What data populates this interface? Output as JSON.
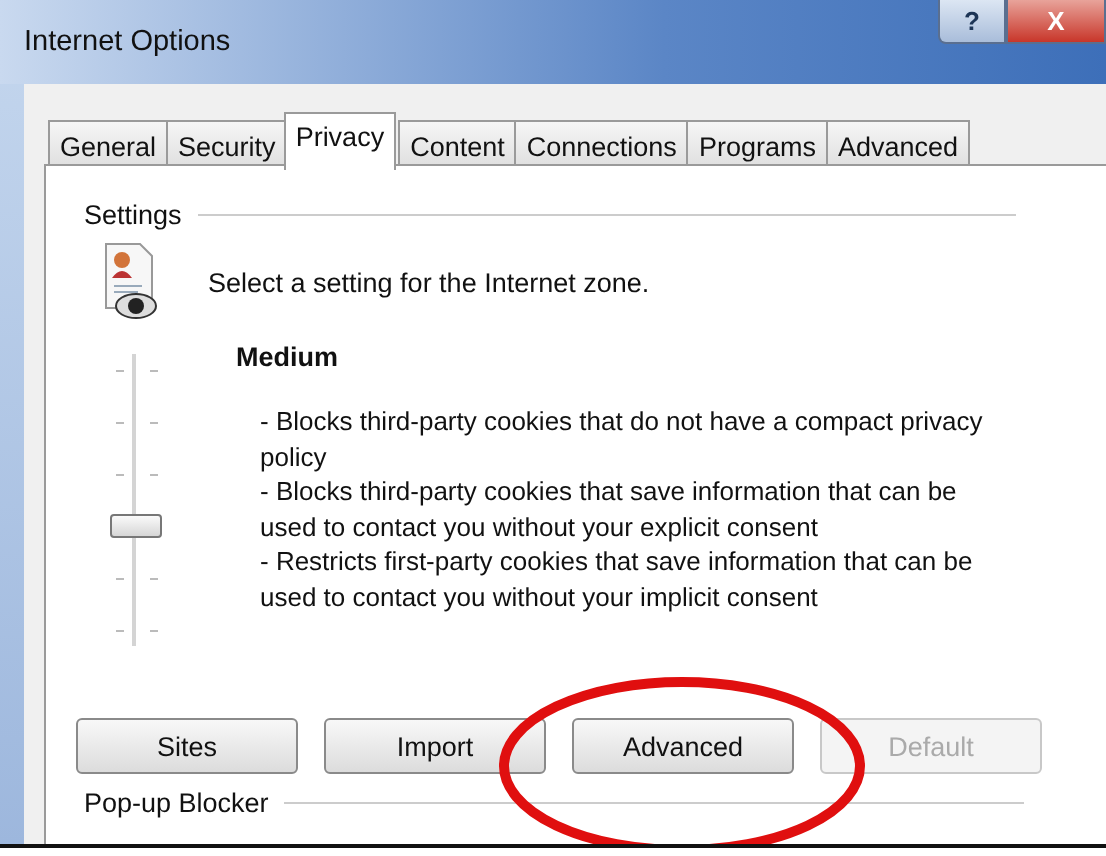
{
  "window": {
    "title": "Internet Options",
    "help_button": "?",
    "close_button": "X"
  },
  "tabs": [
    {
      "label": "General",
      "selected": false
    },
    {
      "label": "Security",
      "selected": false
    },
    {
      "label": "Privacy",
      "selected": true
    },
    {
      "label": "Content",
      "selected": false
    },
    {
      "label": "Connections",
      "selected": false
    },
    {
      "label": "Programs",
      "selected": false
    },
    {
      "label": "Advanced",
      "selected": false
    }
  ],
  "settings": {
    "heading": "Settings",
    "prompt": "Select a setting for the Internet zone.",
    "slider": {
      "level": 0.4
    },
    "level_name": "Medium",
    "description": [
      "- Blocks third-party cookies that do not have a compact privacy policy",
      "- Blocks third-party cookies that save information that can be used to contact you without your explicit consent",
      "- Restricts first-party cookies that save information that can be used to contact you without your implicit consent"
    ]
  },
  "buttons": [
    {
      "label": "Sites",
      "disabled": false,
      "circled": false
    },
    {
      "label": "Import",
      "disabled": false,
      "circled": false
    },
    {
      "label": "Advanced",
      "disabled": false,
      "circled": true
    },
    {
      "label": "Default",
      "disabled": true,
      "circled": false
    }
  ],
  "popup_blocker": {
    "heading": "Pop-up Blocker"
  }
}
